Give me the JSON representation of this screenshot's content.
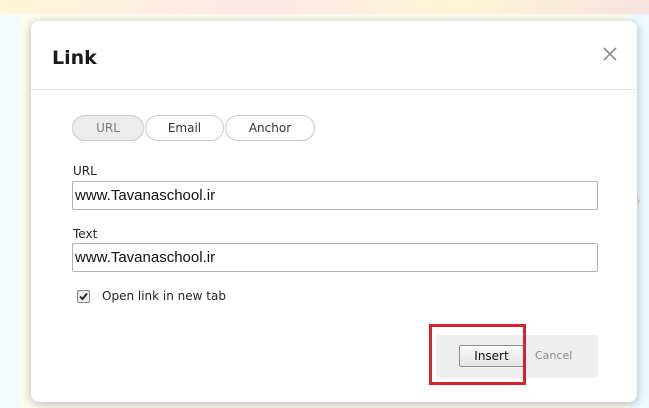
{
  "dialog": {
    "title": "Link",
    "close_icon": "close-icon"
  },
  "tabs": [
    {
      "label": "URL",
      "active": true
    },
    {
      "label": "Email",
      "active": false
    },
    {
      "label": "Anchor",
      "active": false
    }
  ],
  "fields": {
    "url": {
      "label": "URL",
      "value": "www.Tavanaschool.ir"
    },
    "text": {
      "label": "Text",
      "value": "www.Tavanaschool.ir"
    }
  },
  "options": {
    "new_tab_label": "Open link in new tab",
    "new_tab_checked": true
  },
  "footer": {
    "insert_label": "Insert",
    "cancel_label": "Cancel"
  },
  "colors": {
    "highlight": "#d6232c",
    "footer_bg": "#efefef"
  }
}
